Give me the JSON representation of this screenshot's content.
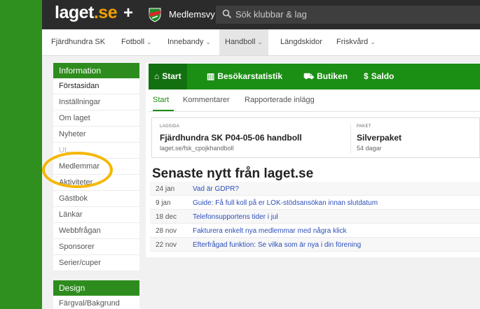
{
  "header": {
    "logo": {
      "main": "laget",
      "suffix": ".se"
    },
    "club_name": "Medlemsvy",
    "search_placeholder": "Sök klubbar & lag"
  },
  "sport_nav": [
    {
      "label": "Fjärdhundra SK",
      "dropdown": false
    },
    {
      "label": "Fotboll",
      "dropdown": true
    },
    {
      "label": "Innebandy",
      "dropdown": true
    },
    {
      "label": "Handboll",
      "dropdown": true,
      "active": true
    },
    {
      "label": "Längdskidor",
      "dropdown": false
    },
    {
      "label": "Friskvård",
      "dropdown": true
    }
  ],
  "sidebar": {
    "information": {
      "heading": "Information",
      "items": [
        "Förstasidan",
        "Inställningar",
        "Om laget",
        "Nyheter",
        "Ut...",
        "Medlemmar",
        "Aktiviteter",
        "Gästbok",
        "Länkar",
        "Webbfrågan",
        "Sponsorer",
        "Serier/cuper"
      ]
    },
    "design": {
      "heading": "Design",
      "items": [
        "Färgval/Bakgrund"
      ]
    }
  },
  "main": {
    "green_tabs": [
      {
        "icon": "home-icon",
        "label": "Start"
      },
      {
        "icon": "bar-chart-icon",
        "label": "Besökarstatistik"
      },
      {
        "icon": "cart-icon",
        "label": "Butiken"
      },
      {
        "icon": "dollar-icon",
        "label": "Saldo"
      }
    ],
    "sub_tabs": [
      "Start",
      "Kommentarer",
      "Rapporterade inlägg"
    ],
    "team_card": {
      "label": "LAGSIDA",
      "name": "Fjärdhundra SK P04-05-06 handboll",
      "url": "laget.se/fsk_cpojkhandboll"
    },
    "package_card": {
      "label": "PAKET",
      "name": "Silverpaket",
      "days": "54 dagar"
    },
    "news": {
      "heading": "Senaste nytt från laget.se",
      "items": [
        {
          "date": "24 jan",
          "title": "Vad är GDPR?"
        },
        {
          "date": "9 jan",
          "title": "Guide: Få full koll på er LOK-stödsansökan innan slutdatum"
        },
        {
          "date": "18 dec",
          "title": "Telefonsupportens tider i jul"
        },
        {
          "date": "28 nov",
          "title": "Fakturera enkelt nya medlemmar med några klick"
        },
        {
          "date": "22 nov",
          "title": "Efterfrågad funktion: Se vilka som är nya i din förening"
        }
      ]
    }
  },
  "colors": {
    "brand_green": "#1a8f14",
    "topbar": "#2b2b2b",
    "link_blue": "#2c4fb8",
    "highlight_circle": "#f5b700"
  }
}
